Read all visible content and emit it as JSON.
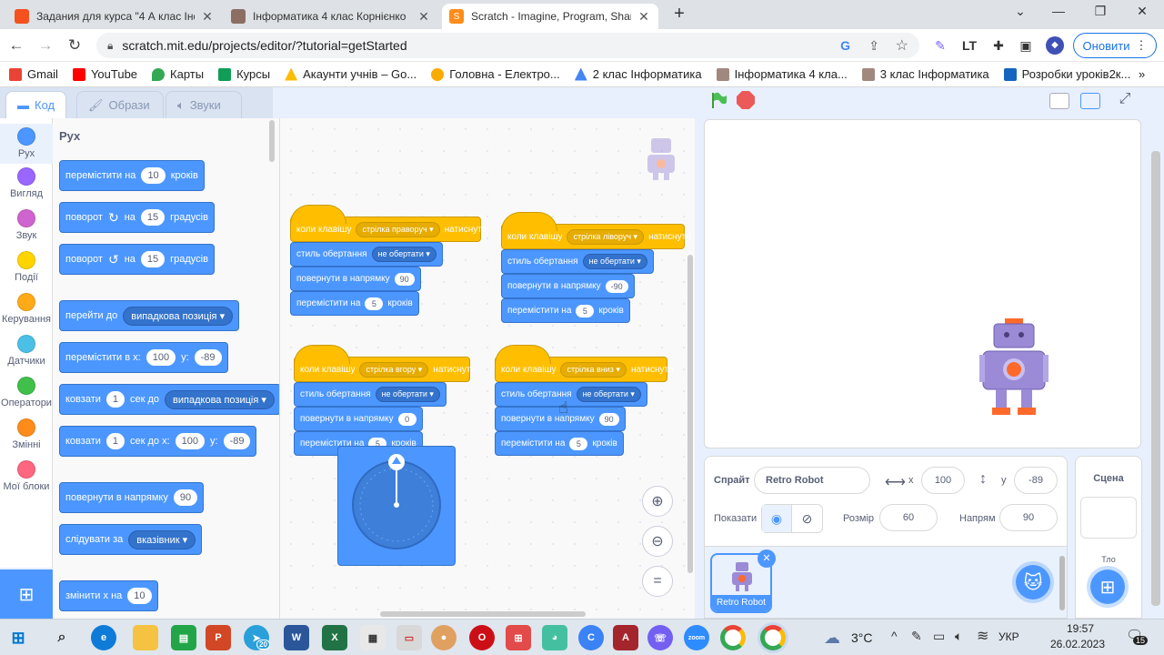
{
  "browser": {
    "tabs": [
      {
        "title": "Задания для курса \"4 А клас Інф",
        "favicon_color": "#f4511e",
        "active": false
      },
      {
        "title": "Інформатика 4 клас Корнієнко",
        "favicon_color": "#8d6e63",
        "active": false
      },
      {
        "title": "Scratch - Imagine, Program, Shar",
        "favicon_color": "#ff8c1a",
        "active": true
      }
    ],
    "url": "scratch.mit.edu/projects/editor/?tutorial=getStarted",
    "update_label": "Оновити",
    "bookmarks": [
      {
        "label": "Gmail",
        "color": "#ea4335"
      },
      {
        "label": "YouTube",
        "color": "#ff0000"
      },
      {
        "label": "Карты",
        "color": "#34a853"
      },
      {
        "label": "Курсы",
        "color": "#0f9d58"
      },
      {
        "label": "Акаунти учнів – Go...",
        "color": "#fbbc04"
      },
      {
        "label": "Головна - Електро...",
        "color": "#f9ab00"
      },
      {
        "label": "2 клас Інформатика",
        "color": "#4285f4"
      },
      {
        "label": "Інформатика 4 кла...",
        "color": "#a1887f"
      },
      {
        "label": "3 клас Інформатика",
        "color": "#a1887f"
      },
      {
        "label": "Розробки уроків2к...",
        "color": "#1565c0"
      }
    ],
    "more_bookmarks": "»"
  },
  "editor_tabs": {
    "code": "Код",
    "costumes": "Образи",
    "sounds": "Звуки"
  },
  "categories": [
    {
      "label": "Рух",
      "color": "#4c97ff"
    },
    {
      "label": "Вигляд",
      "color": "#9966ff"
    },
    {
      "label": "Звук",
      "color": "#cf63cf"
    },
    {
      "label": "Події",
      "color": "#ffd500"
    },
    {
      "label": "Керування",
      "color": "#ffab19"
    },
    {
      "label": "Датчики",
      "color": "#4cbfe6"
    },
    {
      "label": "Оператори",
      "color": "#40bf4a"
    },
    {
      "label": "Змінні",
      "color": "#ff8c1a"
    },
    {
      "label": "Мої блоки",
      "color": "#ff6680"
    }
  ],
  "palette": {
    "heading": "Рух",
    "move": {
      "pre": "перемістити на",
      "val": "10",
      "post": "кроків"
    },
    "turn_right": {
      "pre": "поворот",
      "icon": "↻",
      "mid": "на",
      "val": "15",
      "post": "градусів"
    },
    "turn_left": {
      "pre": "поворот",
      "icon": "↺",
      "mid": "на",
      "val": "15",
      "post": "градусів"
    },
    "goto": {
      "pre": "перейти до",
      "dd": "випадкова позиція"
    },
    "goto_xy": {
      "pre": "перемістити в x:",
      "x": "100",
      "ylab": "y:",
      "y": "-89"
    },
    "glide_to": {
      "pre": "ковзати",
      "val": "1",
      "mid": "сек до",
      "dd": "випадкова позиція"
    },
    "glide_xy": {
      "pre": "ковзати",
      "val": "1",
      "mid": "сек до x:",
      "x": "100",
      "ylab": "y:",
      "y": "-89"
    },
    "point_dir": {
      "pre": "повернути в напрямку",
      "val": "90"
    },
    "point_towards": {
      "pre": "слідувати за",
      "dd": "вказівник"
    },
    "change_x": {
      "pre": "змінити х на",
      "val": "10"
    }
  },
  "scripts": [
    {
      "hat_pre": "коли клавішу",
      "key": "стрілка праворуч",
      "hat_post": "натиснуто",
      "style_lab": "стиль обертання",
      "style": "не обертати",
      "dir_lab": "повернути в напрямку",
      "dir": "90",
      "move_pre": "перемістити на",
      "move": "5",
      "move_post": "кроків"
    },
    {
      "hat_pre": "коли клавішу",
      "key": "стрілка ліворуч",
      "hat_post": "натиснуто",
      "style_lab": "стиль обертання",
      "style": "не обертати",
      "dir_lab": "повернути в напрямку",
      "dir": "-90",
      "move_pre": "перемістити на",
      "move": "5",
      "move_post": "кроків"
    },
    {
      "hat_pre": "коли клавішу",
      "key": "стрілка вгору",
      "hat_post": "натиснуто",
      "style_lab": "стиль обертання",
      "style": "не обертати",
      "dir_lab": "повернути в напрямку",
      "dir": "0",
      "move_pre": "перемістити на",
      "move": "5",
      "move_post": "кроків"
    },
    {
      "hat_pre": "коли клавішу",
      "key": "стрілка вниз",
      "hat_post": "натиснуто",
      "style_lab": "стиль обертання",
      "style": "не обертати",
      "dir_lab": "повернути в напрямку",
      "dir": "90",
      "move_pre": "перемістити на",
      "move": "5",
      "move_post": "кроків"
    }
  ],
  "sprite_info": {
    "sprite_lab": "Спрайт",
    "name": "Retro Robot",
    "x_lab": "x",
    "x": "100",
    "y_lab": "y",
    "y": "-89",
    "show_lab": "Показати",
    "size_lab": "Розмір",
    "size": "60",
    "dir_lab": "Напрям",
    "dir": "90"
  },
  "sprite_thumb": {
    "label": "Retro Robot"
  },
  "stage_panel": {
    "title": "Сцена",
    "backdrop_lab": "Тло"
  },
  "taskbar": {
    "weather": "3°C",
    "lang": "УКР",
    "time": "19:57",
    "date": "26.02.2023",
    "notif_count": "15",
    "telegram_badge": "20"
  }
}
